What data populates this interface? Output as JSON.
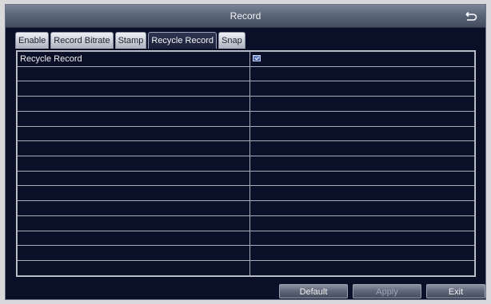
{
  "window": {
    "title": "Record",
    "back_icon": "return-arrow-icon"
  },
  "tabs": [
    {
      "label": "Enable",
      "active": false
    },
    {
      "label": "Record Bitrate",
      "active": false
    },
    {
      "label": "Stamp",
      "active": false
    },
    {
      "label": "Recycle Record",
      "active": true
    },
    {
      "label": "Snap",
      "active": false
    }
  ],
  "table": {
    "rows": [
      {
        "label": "Recycle Record",
        "checked": true
      },
      {
        "label": ""
      },
      {
        "label": ""
      },
      {
        "label": ""
      },
      {
        "label": ""
      },
      {
        "label": ""
      },
      {
        "label": ""
      },
      {
        "label": ""
      },
      {
        "label": ""
      },
      {
        "label": ""
      },
      {
        "label": ""
      },
      {
        "label": ""
      },
      {
        "label": ""
      },
      {
        "label": ""
      },
      {
        "label": ""
      }
    ]
  },
  "footer": {
    "default_label": "Default",
    "apply_label": "Apply",
    "exit_label": "Exit"
  },
  "colors": {
    "background": "#0b1029",
    "active_tab": "#1a2038",
    "inactive_tab": "#c9cdd6",
    "checkbox": "#4f6ab5"
  }
}
